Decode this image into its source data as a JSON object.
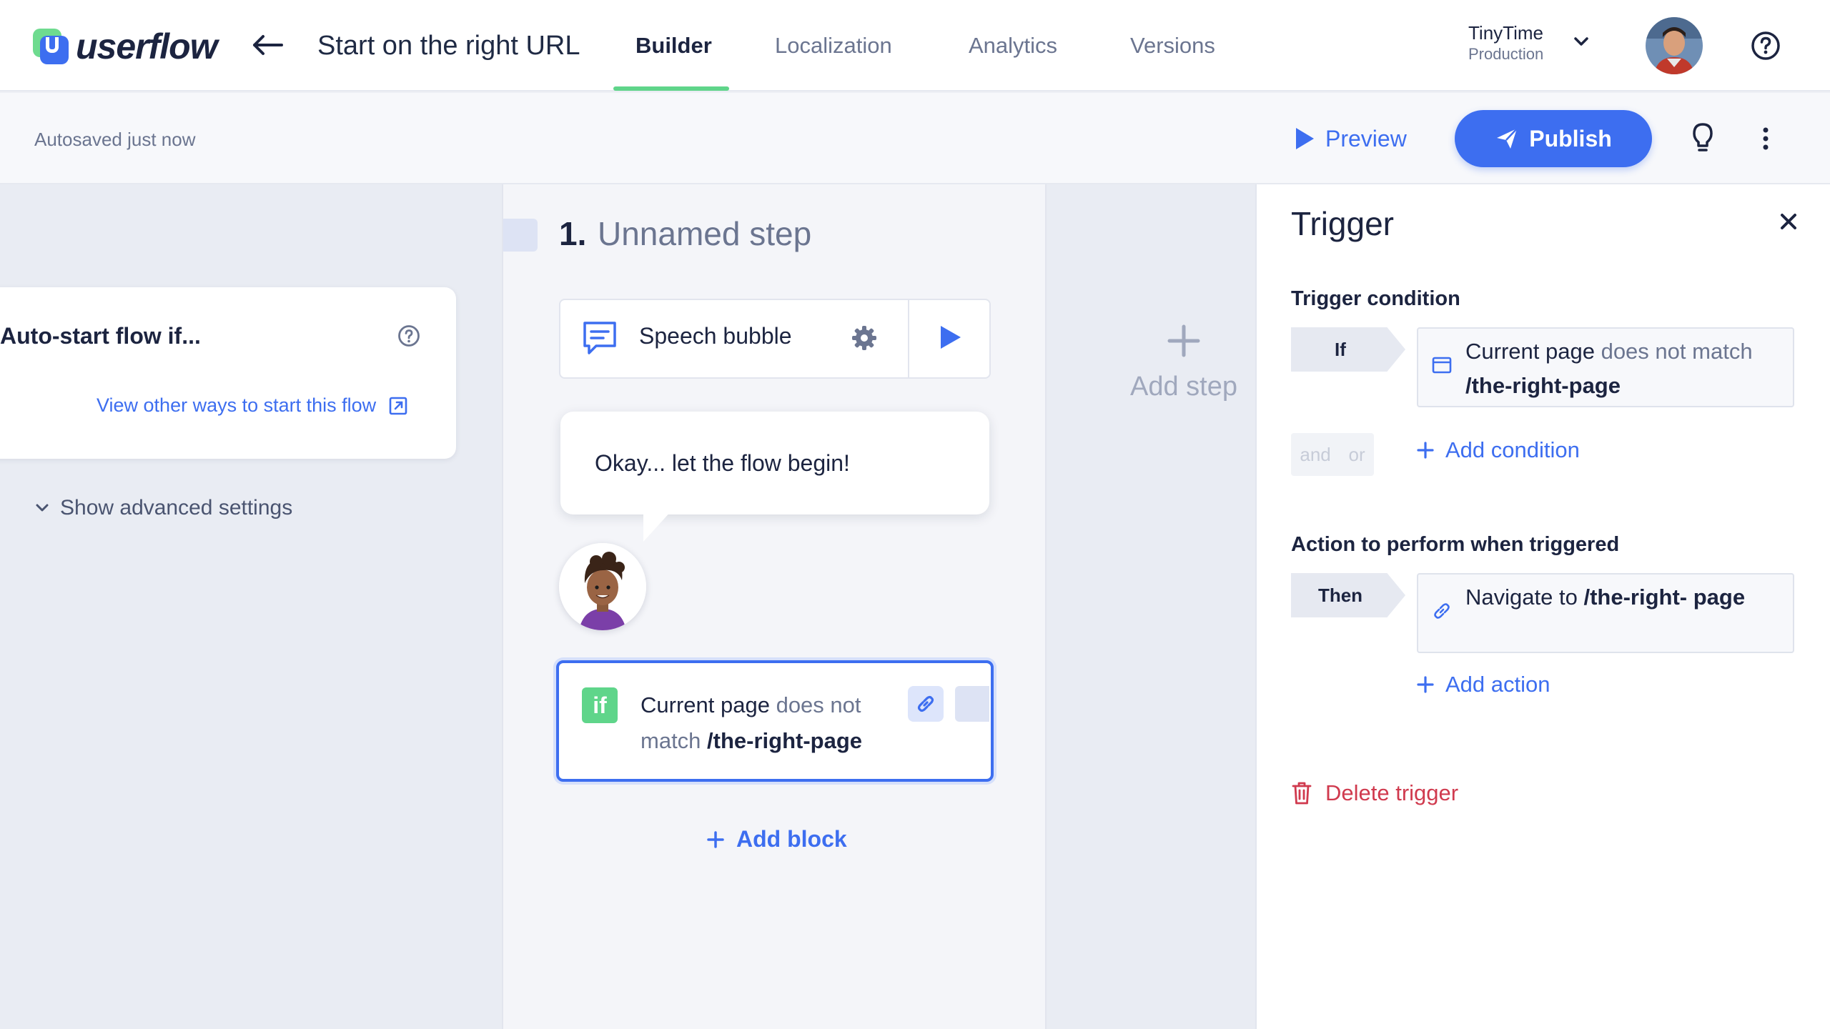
{
  "app": {
    "logo_text": "userflow"
  },
  "header": {
    "flow_title": "Start on the right URL",
    "tabs": [
      {
        "label": "Builder",
        "active": true
      },
      {
        "label": "Localization",
        "active": false
      },
      {
        "label": "Analytics",
        "active": false
      },
      {
        "label": "Versions",
        "active": false
      }
    ],
    "workspace": {
      "name": "TinyTime",
      "environment": "Production"
    }
  },
  "toolbar": {
    "autosave_status": "Autosaved just now",
    "preview_label": "Preview",
    "publish_label": "Publish"
  },
  "left_panel": {
    "autostart_label": "Auto-start flow if...",
    "other_ways_link": "View other ways to start this flow",
    "advanced_settings_label": "Show advanced settings"
  },
  "step": {
    "number": "1.",
    "name": "Unnamed step",
    "block_type": "Speech bubble",
    "message": "Okay... let the flow begin!",
    "condition": {
      "badge": "if",
      "subject": "Current page",
      "operator": "does not",
      "operator2": "match",
      "value": "/the-right-page"
    },
    "add_block_label": "Add block"
  },
  "add_step_label": "Add step",
  "trigger_panel": {
    "title": "Trigger",
    "condition_section_label": "Trigger condition",
    "if_pill": "If",
    "condition": {
      "subject": "Current page",
      "operator": "does not",
      "operator2": "match",
      "value": "/the-right-page"
    },
    "logic_and": "and",
    "logic_or": "or",
    "add_condition_label": "Add condition",
    "action_section_label": "Action to perform when triggered",
    "then_pill": "Then",
    "action": {
      "verb": "Navigate to",
      "value": "/the-right-",
      "value2": "page"
    },
    "add_action_label": "Add action",
    "delete_label": "Delete trigger"
  },
  "colors": {
    "accent": "#3d6ef0",
    "success": "#5fd58a",
    "danger": "#d03a4e",
    "text": "#1c2440",
    "muted": "#6b7590"
  }
}
